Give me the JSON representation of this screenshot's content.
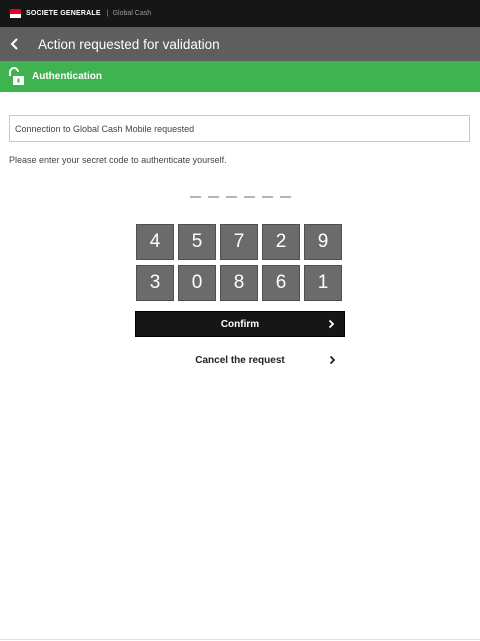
{
  "topbar": {
    "brand": "SOCIETE GENERALE",
    "separator": "|",
    "product": "Global Cash"
  },
  "titlebar": {
    "title": "Action requested for validation",
    "back_icon": "chevron-left-icon"
  },
  "auth": {
    "label": "Authentication",
    "icon": "unlock-icon",
    "color": "#3fb34f"
  },
  "request": {
    "message": "Connection to Global Cash Mobile requested"
  },
  "instructions": "Please enter your secret code to authenticate yourself.",
  "code": {
    "length": 6,
    "entered": 0
  },
  "keypad": {
    "keys": [
      "4",
      "5",
      "7",
      "2",
      "9",
      "3",
      "0",
      "8",
      "6",
      "1"
    ]
  },
  "actions": {
    "confirm_label": "Confirm",
    "cancel_label": "Cancel the request"
  },
  "colors": {
    "brand_red": "#e60028",
    "header_dark": "#161616",
    "title_gray": "#5e5e5e",
    "key_gray": "#6b6b6b"
  }
}
